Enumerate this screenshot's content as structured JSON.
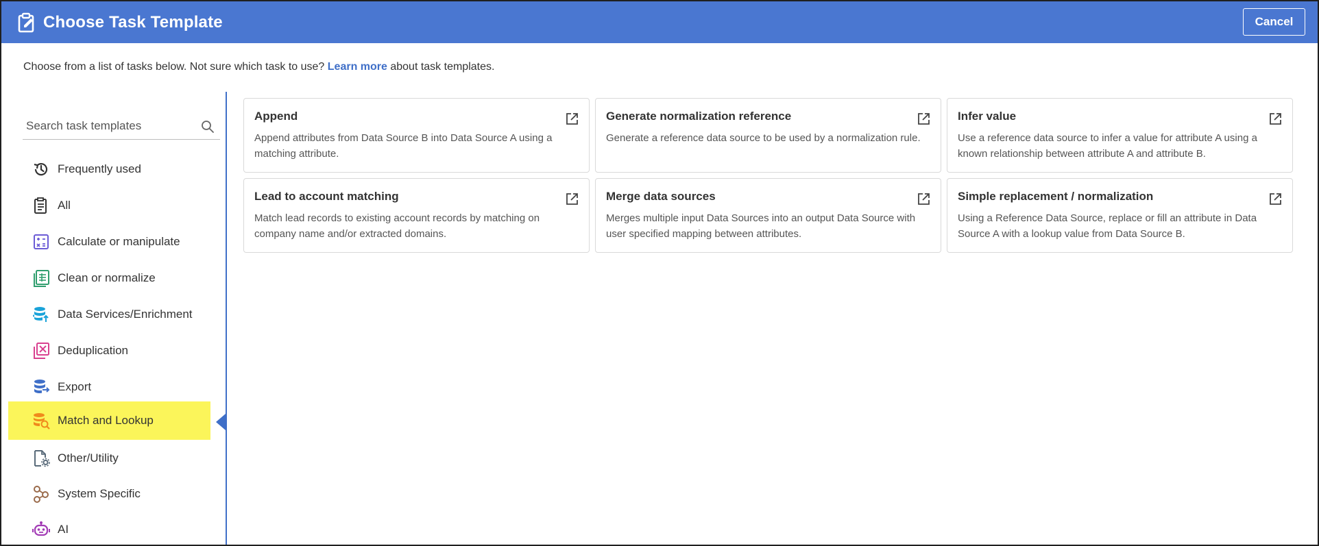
{
  "header": {
    "title": "Choose Task Template",
    "cancel_label": "Cancel",
    "icon": "clipboard-edit-icon",
    "background": "#4a77d1"
  },
  "intro": {
    "prefix": "Choose from a list of tasks below. Not sure which task to use? ",
    "link": "Learn more",
    "suffix": " about task templates."
  },
  "search": {
    "placeholder": "Search task templates",
    "value": "",
    "icon": "search-icon"
  },
  "sidebar": {
    "items": [
      {
        "label": "Frequently used",
        "icon": "history-icon",
        "color": "#333333"
      },
      {
        "label": "All",
        "icon": "clipboard-list-icon",
        "color": "#333333"
      },
      {
        "label": "Calculate or manipulate",
        "icon": "calculator-icon",
        "color": "#6b5bd6"
      },
      {
        "label": "Clean or normalize",
        "icon": "spreadsheet-icon",
        "color": "#2f9e6e"
      },
      {
        "label": "Data Services/Enrichment",
        "icon": "database-upload-icon",
        "color": "#1aa3d9"
      },
      {
        "label": "Deduplication",
        "icon": "remove-duplicate-icon",
        "color": "#d9408f"
      },
      {
        "label": "Export",
        "icon": "database-export-icon",
        "color": "#3f6fc8"
      },
      {
        "label": "Match and Lookup",
        "icon": "database-search-icon",
        "color": "#f08a1c",
        "active": true
      },
      {
        "label": "Other/Utility",
        "icon": "file-settings-icon",
        "color": "#5a6b7a"
      },
      {
        "label": "System Specific",
        "icon": "nodes-icon",
        "color": "#9a6a4a"
      },
      {
        "label": "AI",
        "icon": "robot-icon",
        "color": "#a23bb5"
      }
    ]
  },
  "cards": [
    {
      "title": "Append",
      "description": "Append attributes from Data Source B into Data Source A using a matching attribute."
    },
    {
      "title": "Generate normalization reference",
      "description": "Generate a reference data source to be used by a normalization rule."
    },
    {
      "title": "Infer value",
      "description": "Use a reference data source to infer a value for attribute A using a known relationship between attribute A and attribute B."
    },
    {
      "title": "Lead to account matching",
      "description": "Match lead records to existing account records by matching on company name and/or extracted domains."
    },
    {
      "title": "Merge data sources",
      "description": "Merges multiple input Data Sources into an output Data Source with user specified mapping between attributes."
    },
    {
      "title": "Simple replacement / normalization",
      "description": "Using a Reference Data Source, replace or fill an attribute in Data Source A with a lookup value from Data Source B."
    }
  ],
  "colors": {
    "accent": "#3f6fc8",
    "active_highlight": "#fbf55a"
  }
}
